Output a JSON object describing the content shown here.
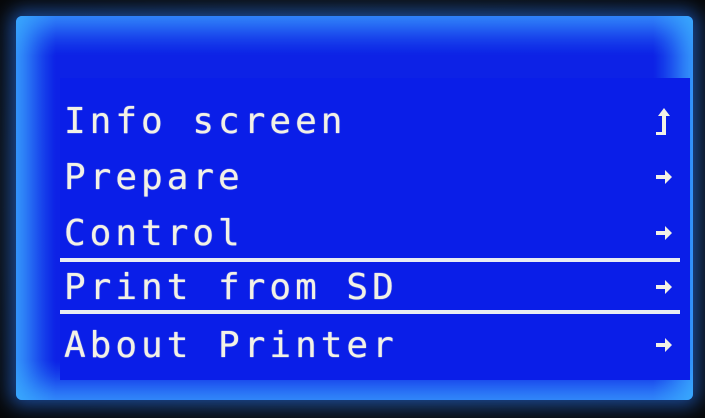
{
  "menu": {
    "items": [
      {
        "label": "Info screen",
        "icon": "back-up-arrow-icon"
      },
      {
        "label": "Prepare",
        "icon": "right-arrow-icon"
      },
      {
        "label": "Control",
        "icon": "right-arrow-icon"
      },
      {
        "label": "Print from SD",
        "icon": "right-arrow-icon",
        "selected": true
      },
      {
        "label": "About Printer",
        "icon": "right-arrow-icon"
      }
    ]
  },
  "colors": {
    "background": "#0a1ee8",
    "text": "#f2f1e6",
    "selection_border": "#e9edf3"
  }
}
